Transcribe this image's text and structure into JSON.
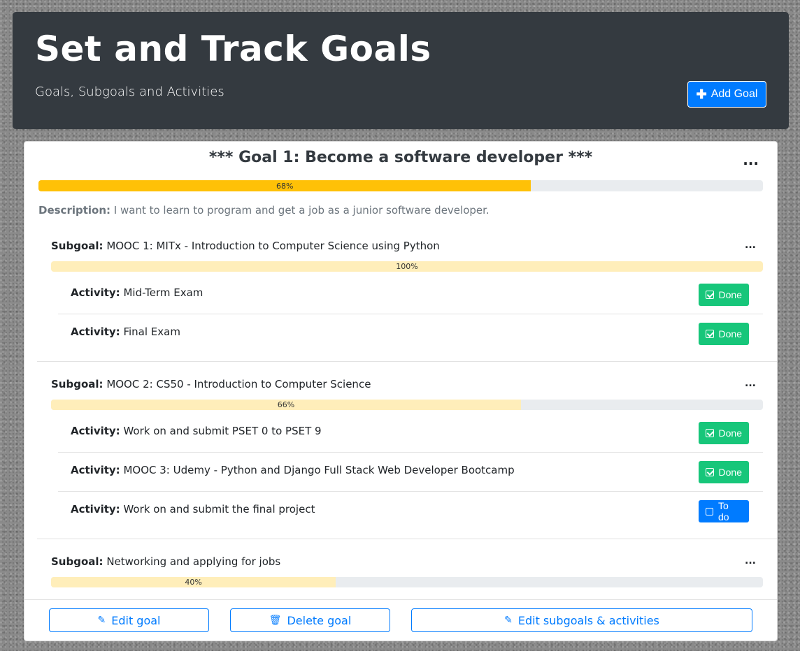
{
  "header": {
    "title": "Set and Track Goals",
    "subtitle": "Goals, Subgoals and Activities",
    "add_goal_label": "Add Goal",
    "add_goal_icon": "plus-icon"
  },
  "goal": {
    "title": "*** Goal 1: Become a software developer ***",
    "menu": "...",
    "progress": 68,
    "progress_label": "68%",
    "progress_color": "#ffc107",
    "description_label": "Description:",
    "description": "I want to learn to program and get a job as a junior software developer."
  },
  "subgoals": [
    {
      "label": "Subgoal:",
      "title": "MOOC 1: MITx - Introduction to Computer Science using Python",
      "menu": "...",
      "progress": 100,
      "progress_label": "100%",
      "activities": [
        {
          "label": "Activity:",
          "text": "Mid-Term Exam",
          "status": "Done"
        },
        {
          "label": "Activity:",
          "text": "Final Exam",
          "status": "Done"
        }
      ]
    },
    {
      "label": "Subgoal:",
      "title": "MOOC 2: CS50 - Introduction to Computer Science",
      "menu": "...",
      "progress": 66,
      "progress_label": "66%",
      "activities": [
        {
          "label": "Activity:",
          "text": "Work on and submit PSET 0 to PSET 9",
          "status": "Done"
        },
        {
          "label": "Activity:",
          "text": "MOOC 3: Udemy - Python and Django Full Stack Web Developer Bootcamp",
          "status": "Done"
        },
        {
          "label": "Activity:",
          "text": "Work on and submit the final project",
          "status": "To do"
        }
      ]
    },
    {
      "label": "Subgoal:",
      "title": "Networking and applying for jobs",
      "menu": "...",
      "progress": 40,
      "progress_label": "40%",
      "activities": []
    }
  ],
  "footer": {
    "edit_goal": "Edit goal",
    "delete_goal": "Delete goal",
    "edit_subgoals": "Edit subgoals & activities"
  },
  "colors": {
    "header_bg": "#343a40",
    "primary": "#007bff",
    "done": "#17c67a",
    "subgoal_progress": "#ffeeba"
  }
}
